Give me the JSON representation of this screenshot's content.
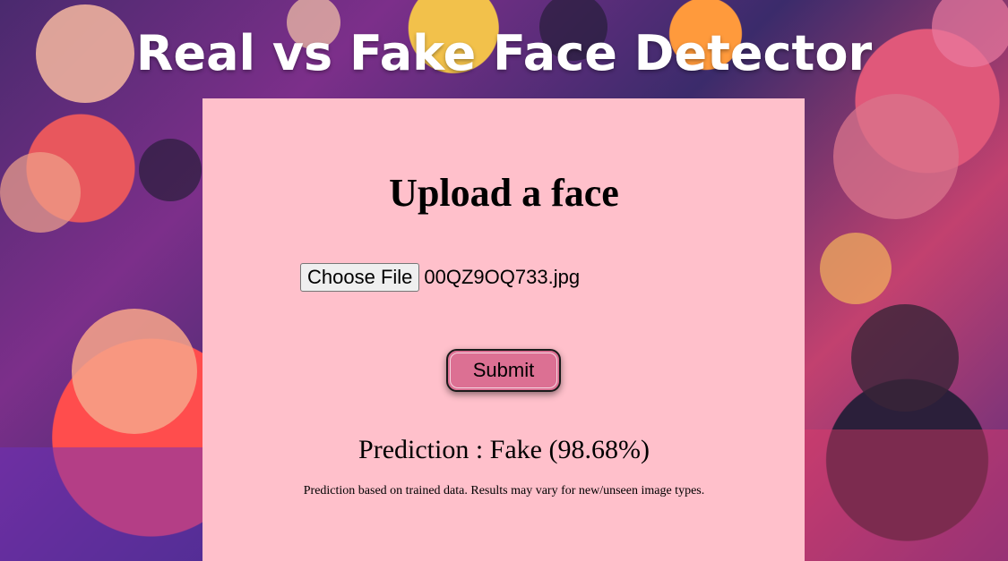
{
  "app": {
    "title": "Real vs Fake Face Detector"
  },
  "form": {
    "heading": "Upload a face",
    "choose_file_label": "Choose File",
    "selected_file": "00QZ9OQ733.jpg",
    "submit_label": "Submit"
  },
  "result": {
    "prediction": "Prediction : Fake (98.68%)",
    "disclaimer": "Prediction based on trained data. Results may vary for new/unseen image types."
  },
  "colors": {
    "card_background": "#ffc0cb",
    "submit_button": "#dc7093",
    "title_text": "#ffffff"
  }
}
